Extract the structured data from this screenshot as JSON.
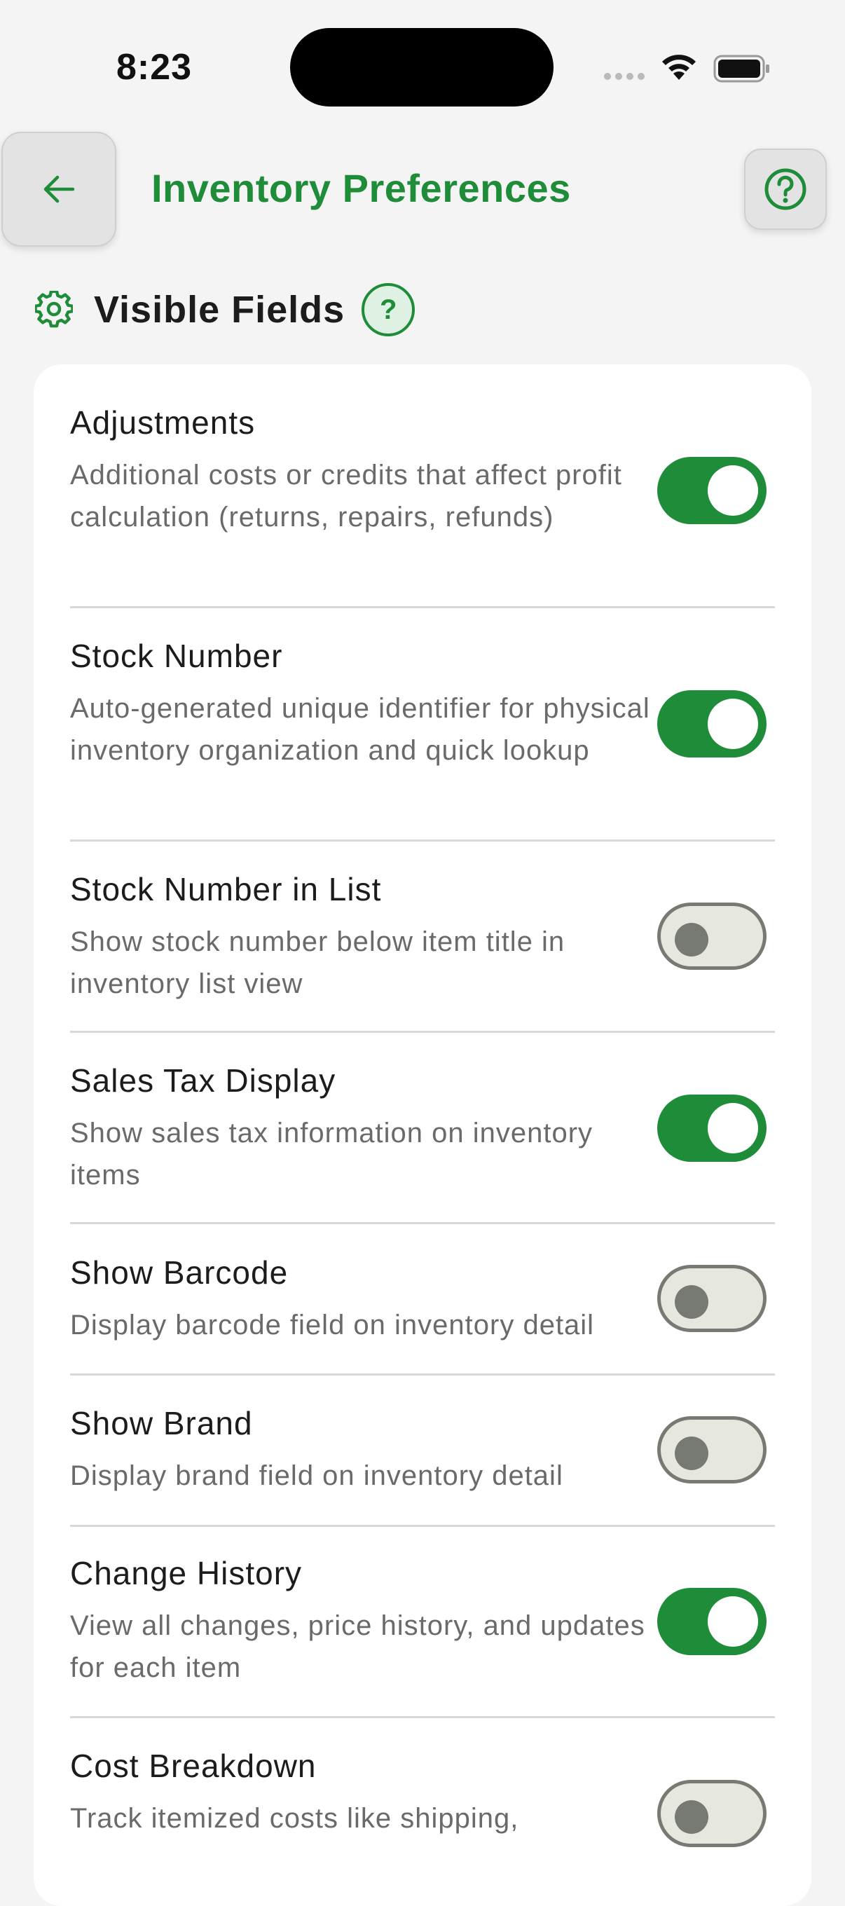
{
  "status_bar": {
    "time": "8:23"
  },
  "header": {
    "title": "Inventory Preferences",
    "back_icon": "arrow-left-icon",
    "help_icon": "help-circle-icon"
  },
  "section": {
    "title": "Visible Fields",
    "icon": "gear-icon",
    "help_label": "?"
  },
  "colors": {
    "accent": "#1e8c38",
    "toggle_off_track": "#e6e8df",
    "toggle_off_border": "#767a73"
  },
  "settings": [
    {
      "title": "Adjustments",
      "description": "Additional costs or credits that affect profit calculation (returns, repairs, refunds)",
      "enabled": true
    },
    {
      "title": "Stock Number",
      "description": "Auto-generated unique identifier for physical inventory organization and quick lookup",
      "enabled": true
    },
    {
      "title": "Stock Number in List",
      "description": "Show stock number below item title in inventory list view",
      "enabled": false
    },
    {
      "title": "Sales Tax Display",
      "description": "Show sales tax information on inventory items",
      "enabled": true
    },
    {
      "title": "Show Barcode",
      "description": "Display barcode field on inventory detail",
      "enabled": false
    },
    {
      "title": "Show Brand",
      "description": "Display brand field on inventory detail",
      "enabled": false
    },
    {
      "title": "Change History",
      "description": "View all changes, price history, and updates for each item",
      "enabled": true
    },
    {
      "title": "Cost Breakdown",
      "description": "Track itemized costs like shipping,",
      "enabled": false
    }
  ]
}
